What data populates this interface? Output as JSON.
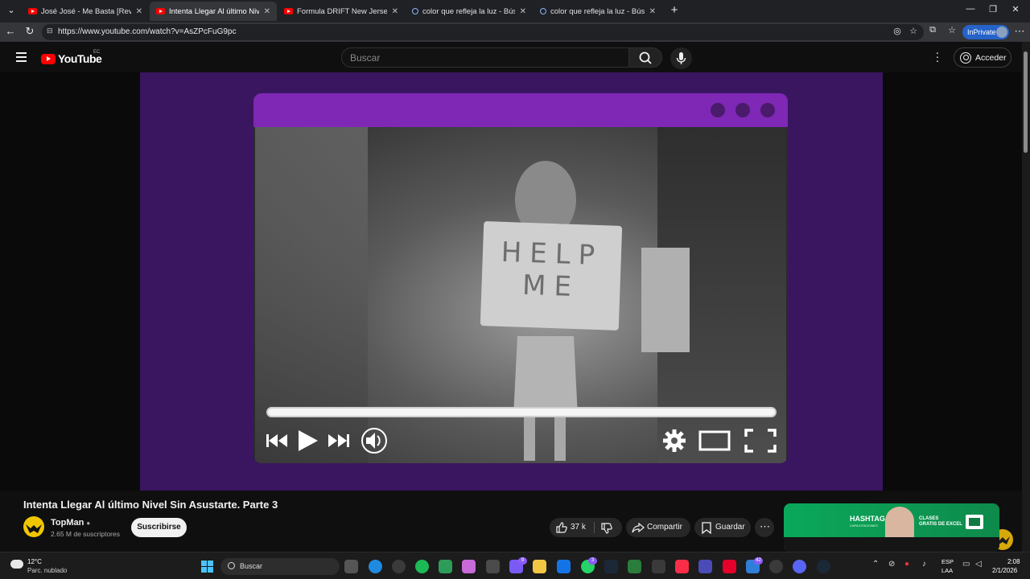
{
  "browser": {
    "tabs": [
      {
        "title": "José José - Me Basta [Revisitado] [L",
        "icon": "youtube-icon",
        "active": false
      },
      {
        "title": "Intenta Llegar Al último Nivel Sin A",
        "icon": "youtube-icon",
        "active": true
      },
      {
        "title": "Formula DRIFT New Jersey 2025 H",
        "icon": "youtube-icon",
        "active": false
      },
      {
        "title": "color que refleja la luz - Búsqueda",
        "icon": "search-icon",
        "active": false
      },
      {
        "title": "color que refleja la luz - Búsqueda",
        "icon": "search-icon",
        "active": false
      }
    ],
    "url": "https://www.youtube.com/watch?v=AsZPcFuG9pc",
    "inprivate_label": "InPrivate"
  },
  "youtube": {
    "logo_text": "YouTube",
    "country_code": "EC",
    "search_placeholder": "Buscar",
    "signin_label": "Acceder"
  },
  "video": {
    "sign_text": "HELP ME",
    "title": "Intenta Llegar Al último Nivel Sin Asustarte. Parte 3",
    "channel": "TopMan",
    "subscribers": "2.65 M de suscriptores",
    "subscribe_label": "Suscribirse",
    "likes": "37 k",
    "share_label": "Compartir",
    "save_label": "Guardar",
    "progress": 0.0
  },
  "ad": {
    "headline": "HASHTAG",
    "subline": "CAPACITACIONES",
    "clases_line1": "CLASES",
    "clases_line2": "GRATIS DE EXCEL"
  },
  "taskbar": {
    "temperature": "12°C",
    "weather": "Parc. nublado",
    "search_label": "Buscar",
    "badge1": "9",
    "badge2": "3",
    "badge3": "42",
    "lang1": "ESP",
    "lang2": "LAA",
    "time": "2:08",
    "date": "2/1/2026"
  },
  "colors": {
    "purple_frame": "#7e28b5",
    "video_bg": "#3a1660",
    "youtube_red": "#ff0000"
  }
}
